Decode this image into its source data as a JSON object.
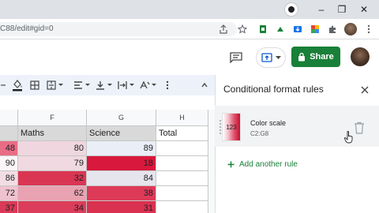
{
  "browser": {
    "url_fragment": "C88/edit#gid=0",
    "window_buttons": [
      "–",
      "❐",
      "✕"
    ]
  },
  "header": {
    "share_label": "Share"
  },
  "sheet": {
    "columns": [
      {
        "letter": "F",
        "header": "Maths"
      },
      {
        "letter": "G",
        "header": "Science"
      },
      {
        "letter": "H",
        "header": "Total"
      }
    ],
    "rows": [
      {
        "e": "48",
        "f": "80",
        "g": "89",
        "h": "",
        "colors": [
          "#e96c85",
          "#efd6df",
          "#e9eef7"
        ]
      },
      {
        "e": "90",
        "f": "79",
        "g": "18",
        "h": "",
        "colors": [
          "#fdf6f8",
          "#f0d9e1",
          "#d8183d"
        ]
      },
      {
        "e": "86",
        "f": "32",
        "g": "84",
        "h": "",
        "colors": [
          "#f3dde5",
          "#da3654",
          "#e6e5ee"
        ]
      },
      {
        "e": "72",
        "f": "62",
        "g": "38",
        "h": "",
        "colors": [
          "#eec3cf",
          "#e9a2b1",
          "#dd3a58"
        ]
      },
      {
        "e": "37",
        "f": "34",
        "g": "31",
        "h": "",
        "colors": [
          "#d93a57",
          "#dc3d5a",
          "#da3150"
        ]
      }
    ]
  },
  "panel": {
    "title": "Conditional format rules",
    "rule": {
      "preview_text": "123",
      "name": "Color scale",
      "range": "C2:G8"
    },
    "add_rule_label": "Add another rule"
  },
  "colors": {
    "share_green": "#188038",
    "scale_high": "#ffffff",
    "scale_low": "#c5102f"
  }
}
